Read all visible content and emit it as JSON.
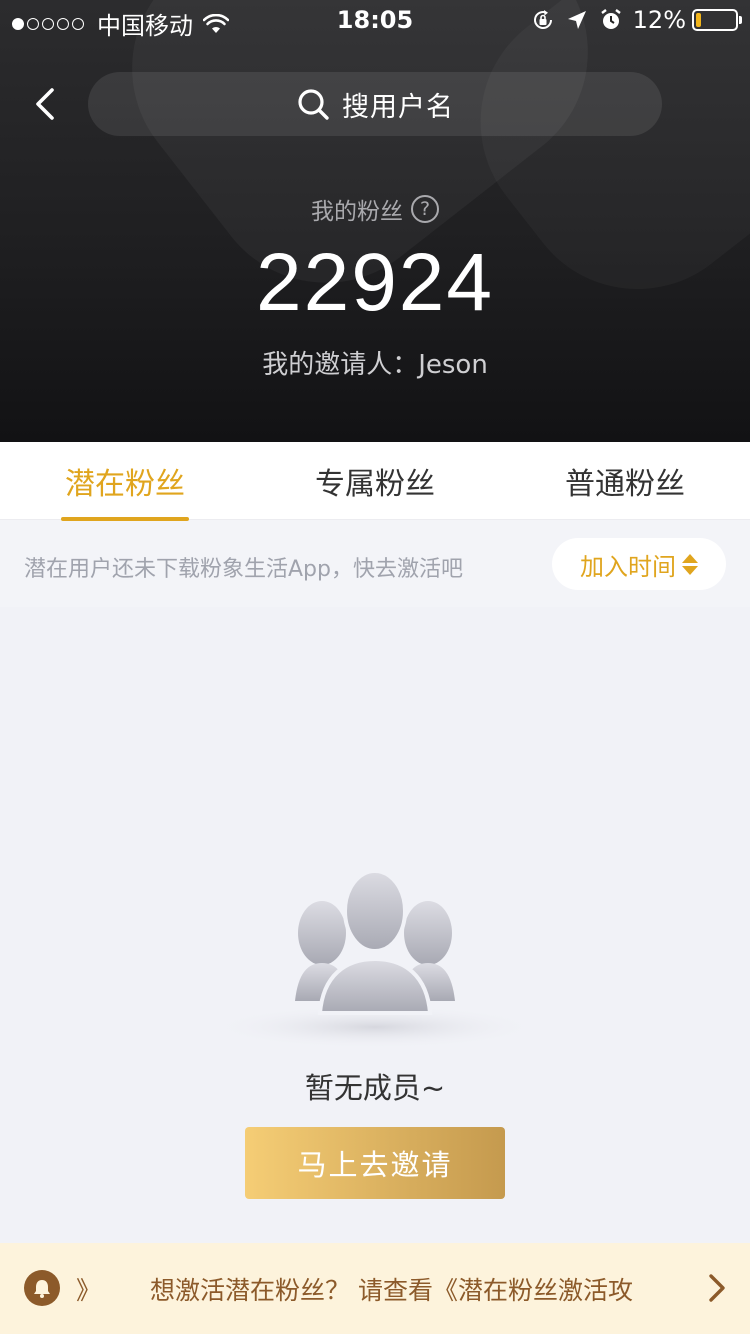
{
  "status_bar": {
    "carrier": "中国移动",
    "time": "18:05",
    "battery_percent": "12%",
    "battery_level": 0.12,
    "signal_strength": 1,
    "signal_max": 5,
    "icons": [
      "wifi-icon",
      "rotation-lock-icon",
      "location-icon",
      "alarm-icon",
      "battery-icon"
    ]
  },
  "nav": {
    "back_icon": "chevron-left-icon",
    "search_icon": "search-icon",
    "search_placeholder": "搜用户名"
  },
  "summary": {
    "fans_label": "我的粉丝",
    "help_icon": "question-circle-icon",
    "help_glyph": "?",
    "fans_count": "22924",
    "inviter_label": "我的邀请人：",
    "inviter_name": "Jeson"
  },
  "tabs": [
    {
      "label": "潜在粉丝",
      "active": true
    },
    {
      "label": "专属粉丝",
      "active": false
    },
    {
      "label": "普通粉丝",
      "active": false
    }
  ],
  "hint": {
    "text": "潜在用户还未下载粉象生活App，快去激活吧",
    "sort_label": "加入时间",
    "sort_icon": "sort-arrows-icon"
  },
  "empty_state": {
    "illustration": "group-users-icon",
    "message": "暂无成员~",
    "button_label": "马上去邀请"
  },
  "notice": {
    "icon": "bell-icon",
    "tail": "》",
    "text": "想激活潜在粉丝？ 请查看《潜在粉丝激活攻",
    "arrow_icon": "chevron-right-icon"
  },
  "colors": {
    "accent": "#e0a51e",
    "header_bg": "#1f1f21",
    "button_gradient_start": "#f5cd75",
    "button_gradient_end": "#c59a4e",
    "notice_bg": "#fdf3dc",
    "notice_text": "#8c5a2a"
  }
}
